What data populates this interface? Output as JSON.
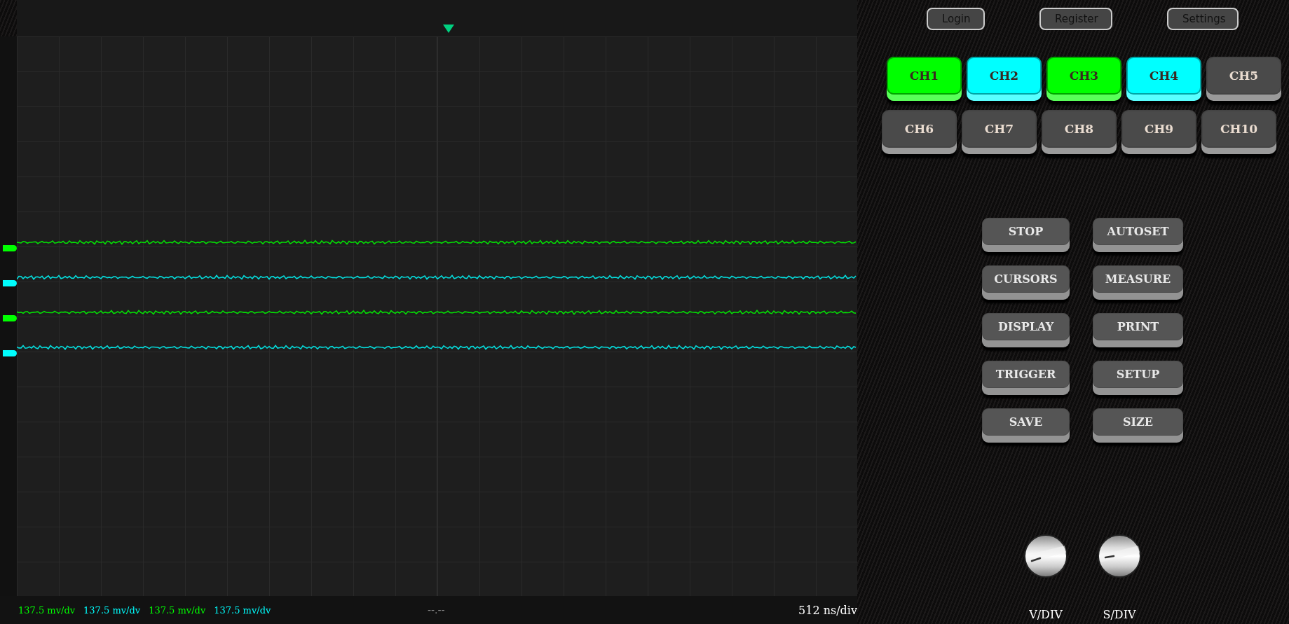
{
  "scope": {
    "traces": [
      {
        "color": "#00ff00"
      },
      {
        "color": "#00ffff"
      },
      {
        "color": "#00ff00"
      },
      {
        "color": "#00ffff"
      }
    ],
    "scales": [
      {
        "text": "137.5 mv/dv",
        "color": "#00ff00"
      },
      {
        "text": "137.5 mv/dv",
        "color": "#00ffff"
      },
      {
        "text": "137.5 mv/dv",
        "color": "#00ff00"
      },
      {
        "text": "137.5 mv/dv",
        "color": "#00ffff"
      }
    ],
    "cursor_readout": "--.--",
    "timebase": "512 ns/div"
  },
  "header_buttons": [
    "Login",
    "Register",
    "Settings"
  ],
  "channels": [
    {
      "label": "CH1",
      "on": true,
      "color": "#00ff00"
    },
    {
      "label": "CH2",
      "on": true,
      "color": "#00ffff"
    },
    {
      "label": "CH3",
      "on": true,
      "color": "#00ff00"
    },
    {
      "label": "CH4",
      "on": true,
      "color": "#00ffff"
    },
    {
      "label": "CH5",
      "on": false
    },
    {
      "label": "CH6",
      "on": false
    },
    {
      "label": "CH7",
      "on": false
    },
    {
      "label": "CH8",
      "on": false
    },
    {
      "label": "CH9",
      "on": false
    },
    {
      "label": "CH10",
      "on": false
    }
  ],
  "functions": [
    "STOP",
    "AUTOSET",
    "CURSORS",
    "MEASURE",
    "DISPLAY",
    "PRINT",
    "TRIGGER",
    "SETUP",
    "SAVE",
    "SIZE"
  ],
  "knobs": [
    {
      "label": "V/DIV"
    },
    {
      "label": "S/DIV"
    }
  ]
}
